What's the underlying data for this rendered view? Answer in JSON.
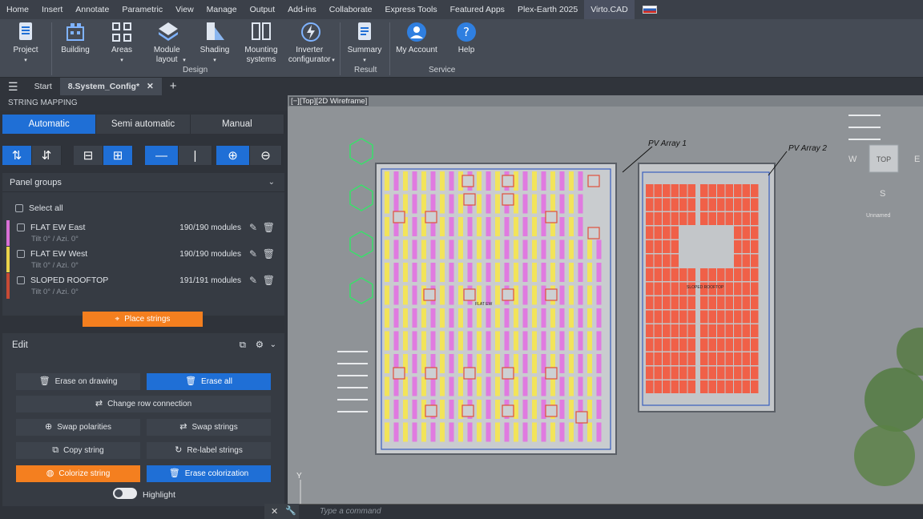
{
  "ribbon_tabs": [
    "Home",
    "Insert",
    "Annotate",
    "Parametric",
    "View",
    "Manage",
    "Output",
    "Add-ins",
    "Collaborate",
    "Express Tools",
    "Featured Apps",
    "Plex-Earth 2025",
    "Virto.CAD"
  ],
  "ribbon": {
    "buttons": [
      {
        "label": "Project",
        "icon": "project-icon"
      },
      {
        "label": "Building",
        "icon": "building-icon"
      },
      {
        "label": "Areas",
        "icon": "areas-icon"
      },
      {
        "label": "Module layout",
        "icon": "module-layout-icon"
      },
      {
        "label": "Shading",
        "icon": "shading-icon"
      },
      {
        "label": "Mounting systems",
        "icon": "mounting-icon"
      },
      {
        "label": "Inverter configurator",
        "icon": "inverter-icon"
      },
      {
        "label": "Summary",
        "icon": "summary-icon"
      },
      {
        "label": "My Account",
        "icon": "account-icon"
      },
      {
        "label": "Help",
        "icon": "help-icon"
      }
    ],
    "groups": [
      "Design",
      "Result",
      "Service"
    ]
  },
  "file_tabs": {
    "start": "Start",
    "active": "8.System_Config*"
  },
  "panel": {
    "title": "STRING MAPPING",
    "modes": [
      "Automatic",
      "Semi automatic",
      "Manual"
    ],
    "groups_title": "Panel groups",
    "select_all": "Select all",
    "groups": [
      {
        "name": "FLAT EW East",
        "count": "190/190 modules",
        "tilt": "Tilt 0° / Azi. 0°",
        "color": "#d96fd6"
      },
      {
        "name": "FLAT EW West",
        "count": "190/190 modules",
        "tilt": "Tilt 0° / Azi. 0°",
        "color": "#e9d34a"
      },
      {
        "name": "SLOPED ROOFTOP",
        "count": "191/191 modules",
        "tilt": "Tilt 0° / Azi. 0°",
        "color": "#c84a35"
      }
    ],
    "place_strings": "Place strings",
    "edit_title": "Edit",
    "edit_buttons": {
      "erase_on_drawing": "Erase on drawing",
      "erase_all": "Erase all",
      "change_row": "Change row connection",
      "swap_polarities": "Swap polarities",
      "swap_strings": "Swap strings",
      "copy_string": "Copy string",
      "relabel": "Re-label strings",
      "colorize": "Colorize string",
      "erase_colorization": "Erase colorization"
    },
    "highlight": "Highlight"
  },
  "viewport": {
    "label": "[−][Top][2D Wireframe]",
    "array1": "PV Array 1",
    "array2": "PV Array 2",
    "flat_label": "FLAT EW",
    "sloped_label": "SLOPED ROOFTOP",
    "viewcube": "TOP",
    "compass": {
      "w": "W",
      "e": "E",
      "s": "S"
    },
    "unnamed": "Unnamed",
    "y_axis": "Y"
  },
  "cmdline_placeholder": "Type a command",
  "colors": {
    "accent": "#1f6fd6",
    "orange": "#f47f1f",
    "magenta": "#e07ae0",
    "yellow": "#f2e45a",
    "red": "#f06048"
  }
}
